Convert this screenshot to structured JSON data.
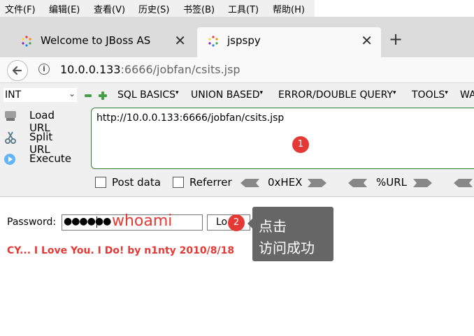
{
  "menu": [
    "文件(F)",
    "编辑(E)",
    "查看(V)",
    "历史(S)",
    "书签(B)",
    "工具(T)",
    "帮助(H)"
  ],
  "tabs": [
    {
      "title": "Welcome to JBoss AS",
      "active": false
    },
    {
      "title": "jspspy",
      "active": true
    }
  ],
  "address": {
    "host": "10.0.0.133",
    "rest": ":6666/jobfan/csits.jsp"
  },
  "hackbar": {
    "select_value": "INT",
    "tools": [
      "SQL BASICS",
      "UNION BASED",
      "ERROR/DOUBLE QUERY",
      "TOOLS",
      "WA"
    ],
    "side": [
      "Load URL",
      "Split URL",
      "Execute"
    ],
    "url_value": "http://10.0.0.133:6666/jobfan/csits.jsp",
    "badge1": "1",
    "options": [
      "Post data",
      "Referrer",
      "0xHEX",
      "%URL"
    ]
  },
  "page": {
    "password_label": "Password:",
    "password_dots": "●●●●●●",
    "annotation": "whoami",
    "login_label": "Lo",
    "badge2": "2",
    "tooltip_line1": "点击",
    "tooltip_line2": "访问成功",
    "message": "CY... I Love You. I Do! by n1nty 2010/8/18"
  },
  "colors": {
    "accent_red": "#e53935",
    "hackbar_green": "#2e7d32",
    "tooltip_bg": "#666666"
  }
}
